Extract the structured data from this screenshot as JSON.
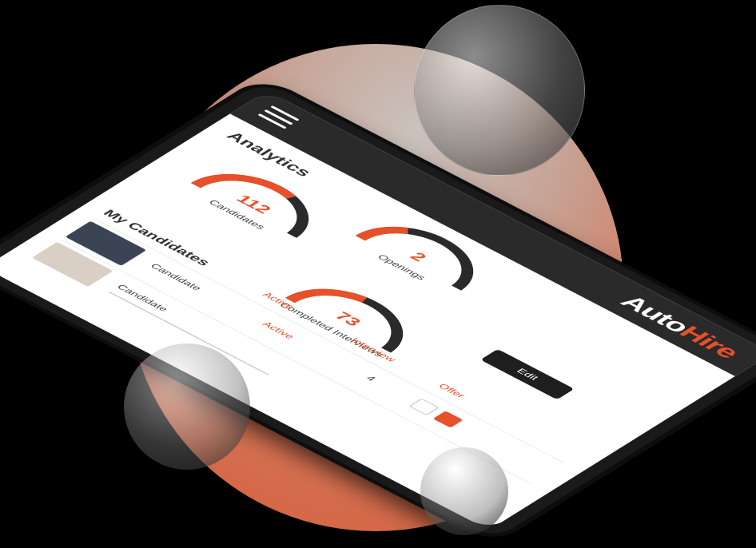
{
  "app": {
    "logo_part1": "Auto",
    "logo_part2": "Hire"
  },
  "analytics": {
    "title": "Analytics",
    "gauges": [
      {
        "value": "112",
        "label": "Candidates",
        "fill": 0.6
      },
      {
        "value": "2",
        "label": "Openings",
        "fill": 0.3
      },
      {
        "value": "73",
        "label": "Completed Interviews",
        "fill": 0.45
      }
    ]
  },
  "edit_button": "Edit",
  "list": {
    "title": "My Candidates",
    "tabs": [
      "Active",
      "Interview",
      "Offer"
    ],
    "rows": [
      {
        "name": "Candidate",
        "status": "Active",
        "count": "4"
      },
      {
        "name": "Candidate",
        "status": "",
        "count": ""
      }
    ]
  },
  "colors": {
    "accent": "#e8502a",
    "dark": "#2a2a2a"
  }
}
